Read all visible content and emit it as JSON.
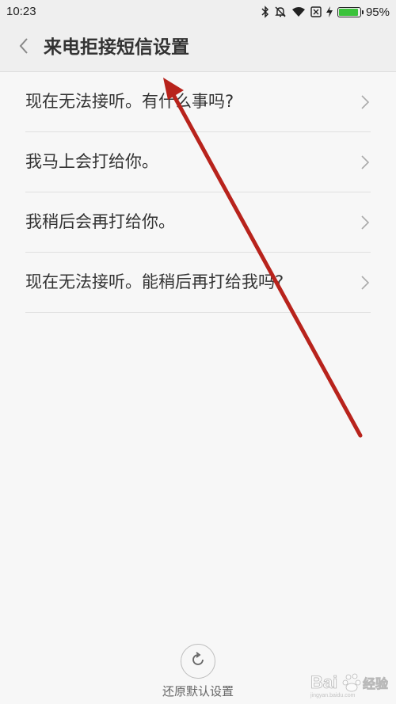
{
  "status_bar": {
    "time": "10:23",
    "battery_percent_text": "95%",
    "battery_level": 0.95,
    "icons": [
      "bluetooth-icon",
      "bell-off-icon",
      "wifi-icon",
      "sim-x-icon",
      "charging-bolt-icon",
      "battery-icon"
    ],
    "battery_color": "#3bc23b"
  },
  "header": {
    "title": "来电拒接短信设置",
    "back_icon": "chevron-left-icon"
  },
  "replies": [
    {
      "text": "现在无法接听。有什么事吗?"
    },
    {
      "text": "我马上会打给你。"
    },
    {
      "text": "我稍后会再打给你。"
    },
    {
      "text": "现在无法接听。能稍后再打给我吗?"
    }
  ],
  "footer": {
    "reset_icon": "refresh-icon",
    "reset_label": "还原默认设置"
  },
  "annotation": {
    "type": "arrow",
    "color": "#b8231c"
  },
  "watermark": {
    "text": "Bai du 经验",
    "sub_text": "jingyan.baidu.com"
  }
}
